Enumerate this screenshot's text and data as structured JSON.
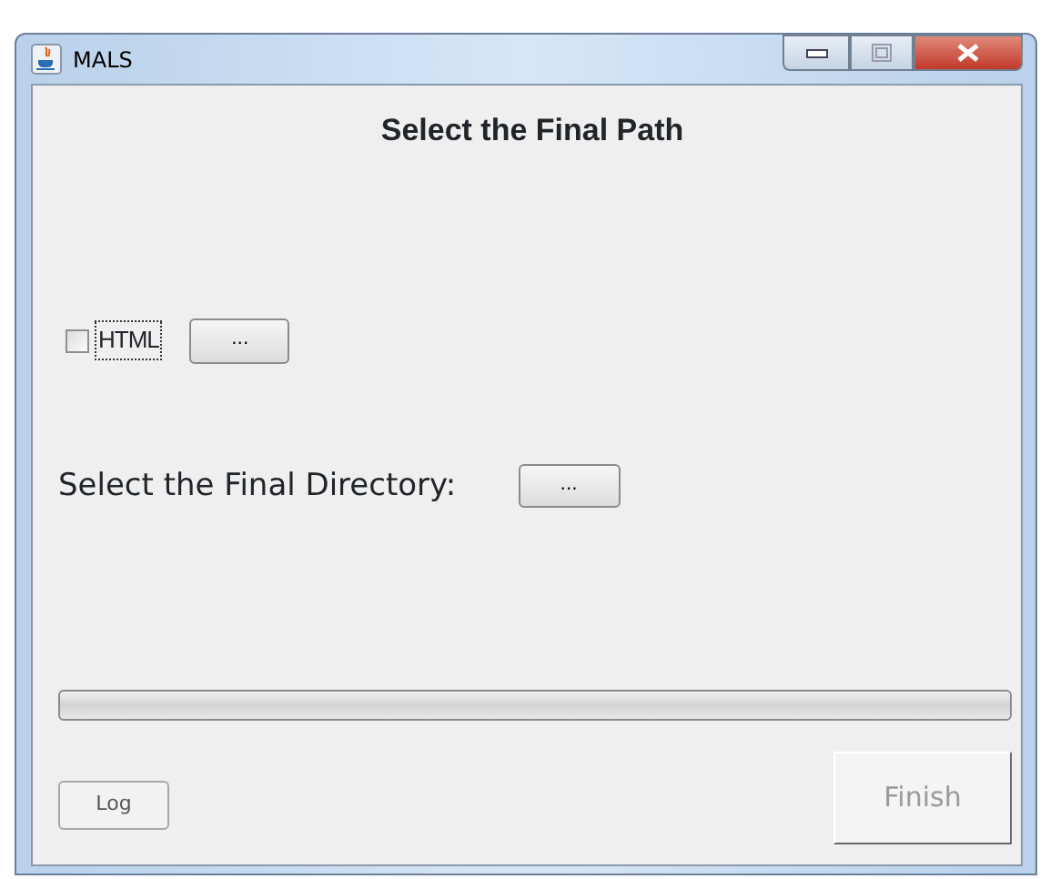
{
  "window": {
    "title": "MALS"
  },
  "heading": "Select the Final Path",
  "html_option": {
    "label": "HTML",
    "checked": false,
    "focused": true,
    "browse_button": "..."
  },
  "directory": {
    "label": "Select the Final Directory:",
    "browse_button": "..."
  },
  "progress": {
    "level": 0
  },
  "buttons": [
    {
      "label": "Log",
      "disabled": false,
      "kind": "small"
    },
    {
      "label": "Finish",
      "disabled": true,
      "kind": "large"
    }
  ]
}
